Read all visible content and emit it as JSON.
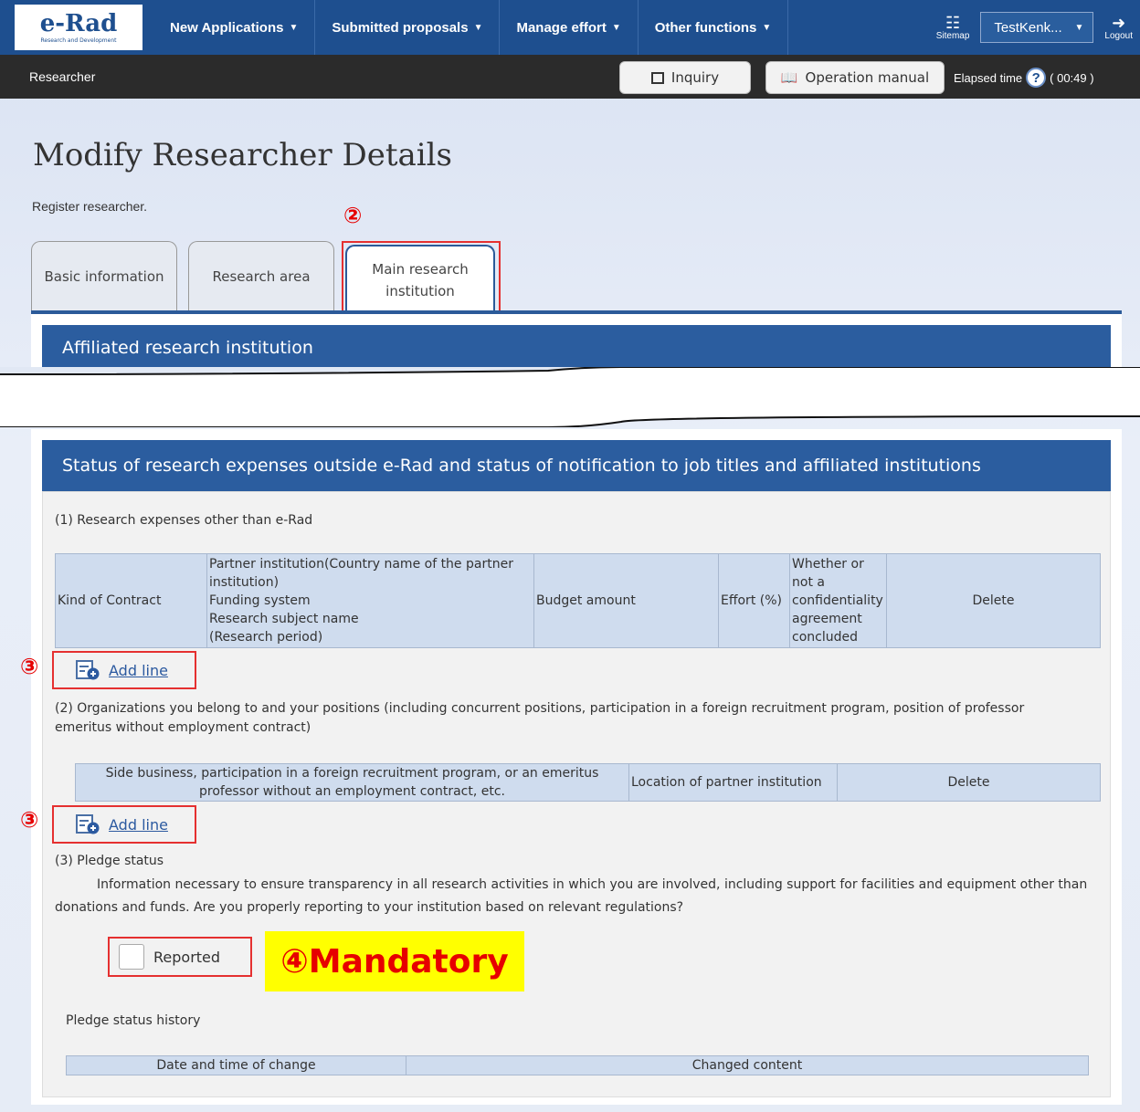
{
  "app": {
    "logo_text": "e-Rad",
    "logo_sub": "Research and Development"
  },
  "nav": {
    "items": [
      {
        "label": "New Applications"
      },
      {
        "label": "Submitted proposals"
      },
      {
        "label": "Manage effort"
      },
      {
        "label": "Other functions"
      }
    ],
    "sitemap_label": "Sitemap",
    "user_value": "TestKenk...",
    "logout_label": "Logout"
  },
  "subbar": {
    "role": "Researcher",
    "inquiry_label": "Inquiry",
    "manual_label": "Operation manual",
    "elapsed_label": "Elapsed time",
    "elapsed_value": "( 00:49 )"
  },
  "page": {
    "title": "Modify Researcher Details",
    "description": "Register researcher."
  },
  "tabs": [
    {
      "label": "Basic information"
    },
    {
      "label": "Research area"
    },
    {
      "label": "Main research institution"
    }
  ],
  "annotations": {
    "tab_marker": "②",
    "add_marker": "③",
    "mandatory": "④Mandatory"
  },
  "sections": {
    "affiliated": "Affiliated research institution",
    "status": "Status of research expenses outside e-Rad and status of notification to job titles and affiliated institutions"
  },
  "expenses": {
    "heading": "(1) Research expenses other than e-Rad",
    "columns": [
      "Kind of Contract",
      "Partner institution(Country name of the partner institution)\nFunding system\nResearch subject name\n(Research period)",
      "Budget amount",
      "Effort (%)",
      "Whether or not a confidentiality agreement concluded",
      "Delete"
    ],
    "add_label": "Add line"
  },
  "organizations": {
    "heading": "(2) Organizations you belong to and your positions (including concurrent positions, participation in a foreign recruitment program, position of professor emeritus without employment contract)",
    "columns": [
      "Side business, participation in a foreign recruitment program, or an emeritus professor without an employment contract, etc.",
      "Location of partner institution",
      "Delete"
    ],
    "add_label": "Add line"
  },
  "pledge": {
    "heading": "(3) Pledge status",
    "text": "Information necessary to ensure transparency in all research activities in which you are involved, including support for facilities and equipment other than donations and funds. Are you properly reporting to your institution based on relevant regulations?",
    "checkbox_label": "Reported",
    "history_label": "Pledge status history",
    "history_columns": [
      "Date and time of change",
      "Changed content"
    ]
  }
}
